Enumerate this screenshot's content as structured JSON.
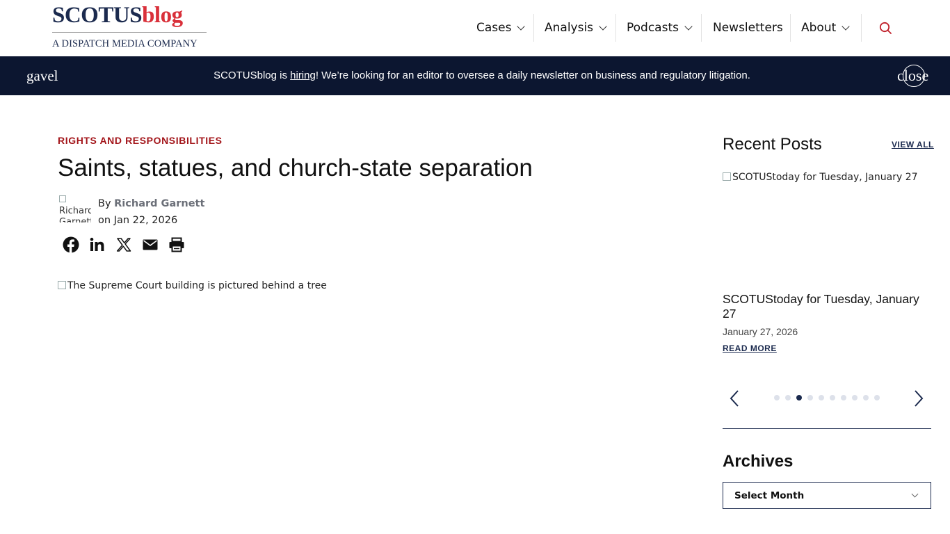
{
  "header": {
    "logo": {
      "scotus": "SCOTUS",
      "blog": "blog",
      "subtitle": "A DISPATCH MEDIA COMPANY"
    },
    "nav": {
      "items": [
        {
          "label": "Cases",
          "has_dropdown": true
        },
        {
          "label": "Analysis",
          "has_dropdown": true
        },
        {
          "label": "Podcasts",
          "has_dropdown": true
        },
        {
          "label": "Newsletters",
          "has_dropdown": false
        },
        {
          "label": "About",
          "has_dropdown": true
        }
      ],
      "search_icon": "search-icon"
    }
  },
  "banner": {
    "left_icon_text": "gavel",
    "text_before": "SCOTUSblog is ",
    "link_text": "hiring",
    "text_after": "! We’re looking for an editor to oversee a daily newsletter on business and regulatory litigation.",
    "close_text": "close"
  },
  "article": {
    "category": "RIGHTS AND RESPONSIBILITIES",
    "title": "Saints, statues, and church-state separation",
    "author_img_alt": "Richard Garnett",
    "byline_prefix": "By ",
    "author": "Richard Garnett",
    "date_prefix": "on ",
    "date": "Jan 22, 2026",
    "share_icons": [
      "facebook-icon",
      "linkedin-icon",
      "x-icon",
      "email-icon",
      "print-icon"
    ],
    "featured_img_alt": "The Supreme Court building is pictured behind a tree"
  },
  "sidebar": {
    "recent_posts_title": "Recent Posts",
    "view_all": "VIEW ALL",
    "post": {
      "img_alt": "SCOTUStoday for Tuesday, January 27",
      "title": "SCOTUStoday for Tuesday, January 27",
      "date": "January 27, 2026",
      "read_more": "READ MORE"
    },
    "carousel": {
      "dot_count": 10,
      "active_index": 2
    },
    "archives_title": "Archives",
    "archives_select": "Select Month"
  },
  "colors": {
    "navy": "#0c1630",
    "brand_navy": "#1b2a4e",
    "brand_red": "#d9303a",
    "category_red": "#a3151a"
  }
}
